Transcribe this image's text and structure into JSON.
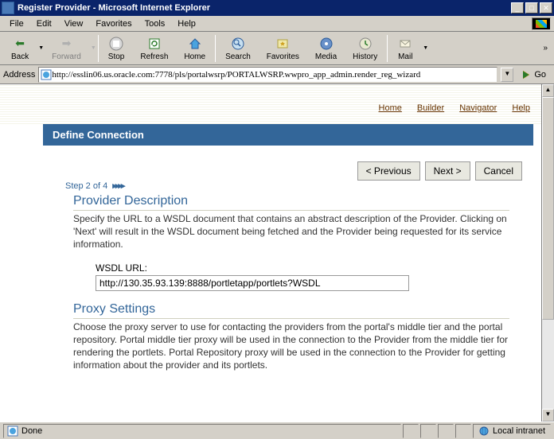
{
  "window": {
    "title": "Register Provider - Microsoft Internet Explorer"
  },
  "menu": {
    "file": "File",
    "edit": "Edit",
    "view": "View",
    "favorites": "Favorites",
    "tools": "Tools",
    "help": "Help"
  },
  "toolbar": {
    "back": "Back",
    "forward": "Forward",
    "stop": "Stop",
    "refresh": "Refresh",
    "home": "Home",
    "search": "Search",
    "favorites": "Favorites",
    "media": "Media",
    "history": "History",
    "mail": "Mail"
  },
  "addressbar": {
    "label": "Address",
    "url": "http://esslin06.us.oracle.com:7778/pls/portalwsrp/PORTALWSRP.wwpro_app_admin.render_reg_wizard",
    "go": "Go"
  },
  "links": {
    "home": "Home",
    "builder": "Builder",
    "navigator": "Navigator",
    "help": "Help"
  },
  "banner": {
    "title": "Define Connection"
  },
  "nav_buttons": {
    "previous": "< Previous",
    "next": "Next >",
    "cancel": "Cancel"
  },
  "step": {
    "text": "Step 2 of 4",
    "arrows": "▸▸▸▸"
  },
  "provider_description": {
    "title": "Provider Description",
    "body": "Specify the URL to a WSDL document that contains an abstract description of the Provider. Clicking on 'Next' will result in the WSDL document being fetched and the Provider being requested for its service information.",
    "field_label": "WSDL URL:",
    "field_value": "http://130.35.93.139:8888/portletapp/portlets?WSDL"
  },
  "proxy_settings": {
    "title": "Proxy Settings",
    "body": "Choose the proxy server to use for contacting the providers from the portal's middle tier and the portal repository. Portal middle tier proxy will be used in the connection to the Provider from the middle tier for rendering the portlets. Portal Repository proxy will be used in the connection to the Provider for getting information about the provider and its portlets."
  },
  "status": {
    "done": "Done",
    "zone": "Local intranet"
  }
}
